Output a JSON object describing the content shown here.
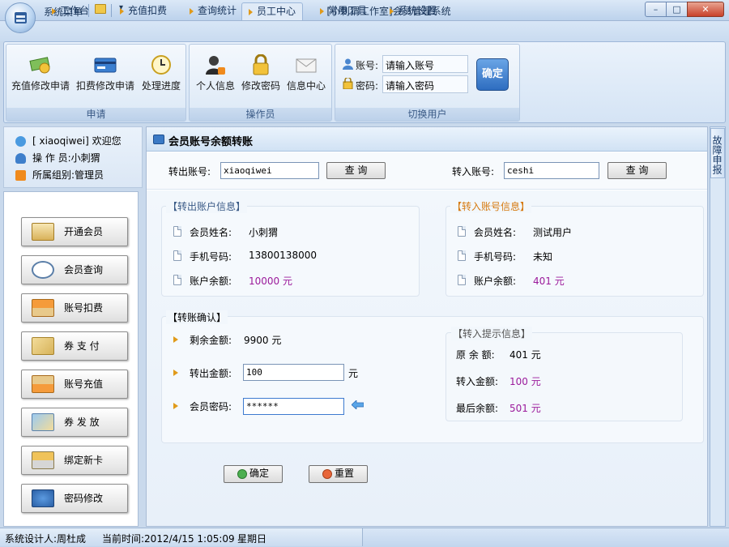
{
  "window": {
    "title": "[小刺猬工作室]会员管理系统",
    "menu_label": "系统菜单",
    "quick_access_dropdown": "▾",
    "min_label": "–",
    "max_label": "□",
    "close_label": "✕"
  },
  "tabs": [
    {
      "label": "工作台"
    },
    {
      "label": "充值扣费"
    },
    {
      "label": "查询统计"
    },
    {
      "label": "员工中心",
      "active": true
    },
    {
      "label": "常用工具"
    },
    {
      "label": "系统设置"
    }
  ],
  "ribbon": {
    "groups": [
      {
        "label": "申请",
        "buttons": [
          {
            "label": "充值修改申请",
            "icon": "money-icon"
          },
          {
            "label": "扣费修改申请",
            "icon": "card-icon"
          },
          {
            "label": "处理进度",
            "icon": "clock-icon"
          }
        ]
      },
      {
        "label": "操作员",
        "buttons": [
          {
            "label": "个人信息",
            "icon": "person-icon"
          },
          {
            "label": "修改密码",
            "icon": "lock-icon"
          },
          {
            "label": "信息中心",
            "icon": "mail-icon"
          }
        ]
      },
      {
        "label": "切换用户"
      }
    ],
    "account_label": "账号:",
    "account_placeholder": "请输入账号",
    "password_label": "密码:",
    "password_placeholder": "请输入密码",
    "confirm_label": "确定"
  },
  "user_info": {
    "welcome": "[ xiaoqiwei] 欢迎您",
    "operator": "操 作 员:小刺猬",
    "group": "所属组别:管理员"
  },
  "nav": [
    {
      "label": "开通会员",
      "icon": "wallet-icon"
    },
    {
      "label": "会员查询",
      "icon": "magnifier-icon"
    },
    {
      "label": "账号扣费",
      "icon": "upload-icon"
    },
    {
      "label": "券 支 付",
      "icon": "coupon-pay-icon"
    },
    {
      "label": "账号充值",
      "icon": "download-icon"
    },
    {
      "label": "券 发 放",
      "icon": "coupon-issue-icon"
    },
    {
      "label": "绑定新卡",
      "icon": "bind-card-icon"
    },
    {
      "label": "密码修改",
      "icon": "password-icon"
    }
  ],
  "fault_report": "故障申报",
  "main": {
    "title": "会员账号余额转账",
    "from_label": "转出账号:",
    "from_value": "xiaoqiwei",
    "to_label": "转入账号:",
    "to_value": "ceshi",
    "query_label": "查 询",
    "out_info": {
      "title": "【转出账户信息】",
      "rows": [
        {
          "label": "会员姓名:",
          "value": "小刺猬"
        },
        {
          "label": "手机号码:",
          "value": "13800138000"
        },
        {
          "label": "账户余额:",
          "value": "10000 元"
        }
      ]
    },
    "in_info": {
      "title": "【转入账号信息】",
      "rows": [
        {
          "label": "会员姓名:",
          "value": "测试用户"
        },
        {
          "label": "手机号码:",
          "value": "未知"
        },
        {
          "label": "账户余额:",
          "value": "401 元"
        }
      ]
    },
    "confirm_section": {
      "title": "【转账确认】",
      "remaining_label": "剩余金额:",
      "remaining_value": "9900 元",
      "amount_label": "转出金额:",
      "amount_value": "100",
      "amount_unit": "元",
      "password_label": "会员密码:",
      "password_value": "******"
    },
    "in_tip": {
      "title": "【转入提示信息】",
      "original_label": "原 余 额:",
      "original_value": "401 元",
      "transfer_label": "转入金额:",
      "transfer_value": "100 元",
      "final_label": "最后余额:",
      "final_value": "501 元"
    },
    "ok_label": "确定",
    "reset_label": "重置"
  },
  "status": {
    "designer": "系统设计人:周杜成",
    "time": "当前时间:2012/4/15 1:05:09",
    "weekday": "星期日"
  },
  "colors": {
    "accent": "#2e6dc0",
    "value_purple": "#9b1a9b",
    "title_blue": "#3a5a86"
  }
}
